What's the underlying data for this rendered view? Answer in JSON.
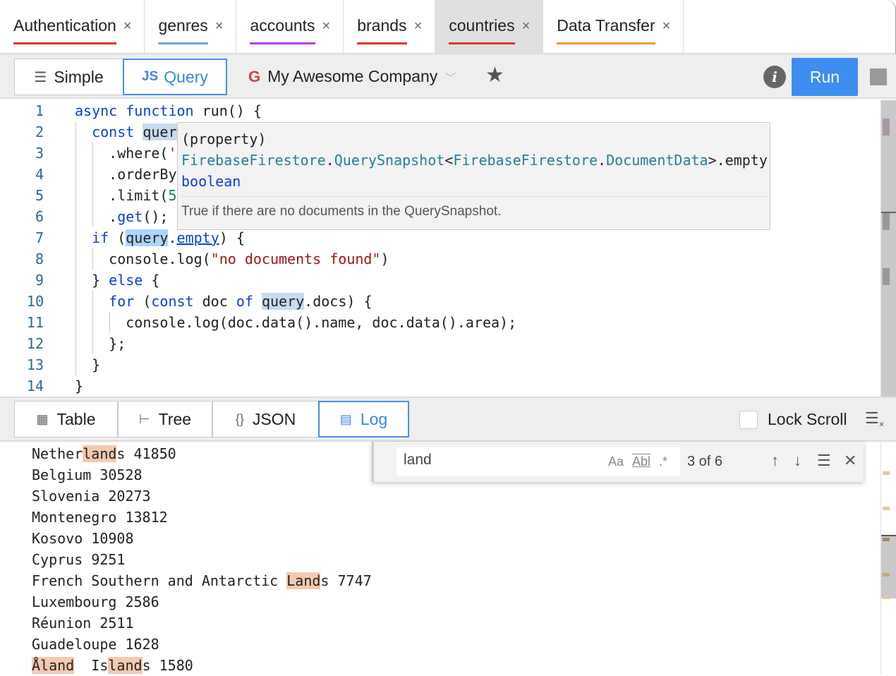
{
  "tabs": [
    {
      "label": "Authentication",
      "color": "#d33b2c"
    },
    {
      "label": "genres",
      "color": "#6fa3e0"
    },
    {
      "label": "accounts",
      "color": "#b53fe0"
    },
    {
      "label": "brands",
      "color": "#d33b2c"
    },
    {
      "label": "countries",
      "color": "#d33b2c",
      "active": true
    },
    {
      "label": "Data Transfer",
      "color": "#eb9a3a"
    }
  ],
  "toolbar": {
    "simple": "Simple",
    "js_icon": "JS",
    "query": "Query",
    "connection": "My Awesome Company",
    "run": "Run",
    "info": "i"
  },
  "editor": {
    "lines": [
      [
        [
          "kw",
          "async "
        ],
        [
          "kw",
          "function "
        ],
        [
          "",
          "run() {"
        ]
      ],
      [
        [
          "",
          "  "
        ],
        [
          "kw",
          "const "
        ],
        [
          "hl",
          "quer"
        ]
      ],
      [
        [
          "",
          "    .where("
        ],
        [
          "str",
          "'"
        ]
      ],
      [
        [
          "",
          "    .orderBy"
        ]
      ],
      [
        [
          "",
          "    .limit("
        ],
        [
          "num",
          "5"
        ]
      ],
      [
        [
          "",
          "    ."
        ],
        [
          "fn",
          "get"
        ],
        [
          "",
          "();"
        ]
      ],
      [
        [
          "",
          "  "
        ],
        [
          "kw",
          "if "
        ],
        [
          "",
          "("
        ],
        [
          "hl2",
          "query"
        ],
        [
          "",
          "."
        ],
        [
          "link",
          "empty"
        ],
        [
          "",
          ") {"
        ]
      ],
      [
        [
          "",
          "    console.log("
        ],
        [
          "str",
          "\"no documents found\""
        ],
        [
          "",
          ")"
        ]
      ],
      [
        [
          "",
          "  } "
        ],
        [
          "kw",
          "else "
        ],
        [
          "",
          "{"
        ]
      ],
      [
        [
          "",
          "    "
        ],
        [
          "kw",
          "for "
        ],
        [
          "",
          "("
        ],
        [
          "kw",
          "const "
        ],
        [
          "",
          "doc "
        ],
        [
          "kw",
          "of "
        ],
        [
          "hl",
          "query"
        ],
        [
          "",
          ".docs) {"
        ]
      ],
      [
        [
          "",
          "      console.log(doc.data().name, doc.data().area);"
        ]
      ],
      [
        [
          "",
          "    };"
        ]
      ],
      [
        [
          "",
          "  }"
        ]
      ],
      [
        [
          "",
          "}"
        ]
      ]
    ]
  },
  "tooltip": {
    "line1": "(property)",
    "sig": [
      [
        "teal",
        "FirebaseFirestore"
      ],
      [
        "",
        "."
      ],
      [
        "teal",
        "QuerySnapshot"
      ],
      [
        "",
        "<"
      ],
      [
        "teal",
        "FirebaseFirestore"
      ],
      [
        "",
        "."
      ],
      [
        "teal",
        "DocumentData"
      ],
      [
        "",
        ">.empty"
      ]
    ],
    "type": "boolean",
    "doc": "True if there are no documents in the QuerySnapshot."
  },
  "results": {
    "tabs": [
      "Table",
      "Tree",
      "JSON",
      "Log"
    ],
    "active": "Log",
    "lock_scroll": "Lock Scroll"
  },
  "log": [
    [
      [
        "",
        "Nether"
      ],
      [
        "m",
        "land"
      ],
      [
        "",
        "s 41850"
      ]
    ],
    [
      [
        "",
        "Belgium 30528"
      ]
    ],
    [
      [
        "",
        "Slovenia 20273"
      ]
    ],
    [
      [
        "",
        "Montenegro 13812"
      ]
    ],
    [
      [
        "",
        "Kosovo 10908"
      ]
    ],
    [
      [
        "",
        "Cyprus 9251"
      ]
    ],
    [
      [
        "",
        "French Southern and Antarctic "
      ],
      [
        "m",
        "Land"
      ],
      [
        "",
        "s 7747"
      ]
    ],
    [
      [
        "",
        "Luxembourg 2586"
      ]
    ],
    [
      [
        "",
        "Réunion 2511"
      ]
    ],
    [
      [
        "",
        "Guadeloupe 1628"
      ]
    ],
    [
      [
        "m",
        "Åland"
      ],
      [
        "",
        "  Is"
      ],
      [
        "m",
        "land"
      ],
      [
        "",
        "s 1580"
      ]
    ]
  ],
  "find": {
    "query": "land",
    "match_case": "Aa",
    "whole_word": "Abl",
    "regex": ".*",
    "count": "3 of 6"
  }
}
